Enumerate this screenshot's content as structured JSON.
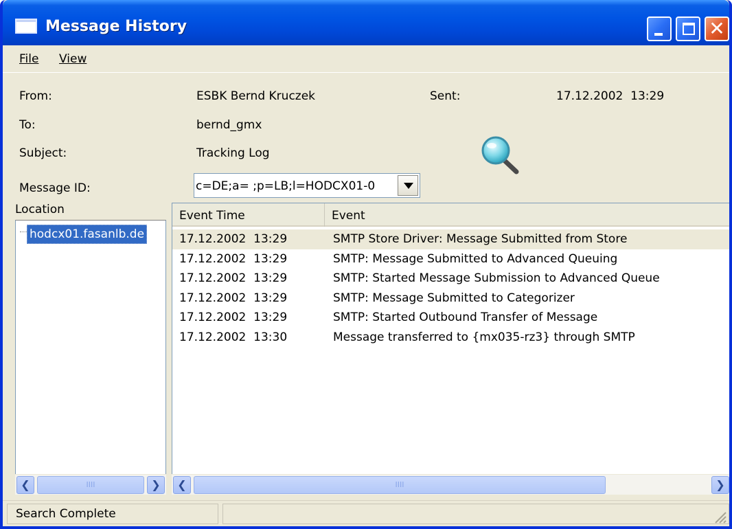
{
  "window": {
    "title": "Message History"
  },
  "menu": {
    "file": "File",
    "view": "View"
  },
  "header": {
    "from_label": "From:",
    "from_value": "ESBK Bernd Kruczek",
    "sent_label": "Sent:",
    "sent_value": "17.12.2002  13:29",
    "to_label": "To:",
    "to_value": "bernd_gmx",
    "subject_label": "Subject:",
    "subject_value": "Tracking Log",
    "msgid_label": "Message ID:",
    "msgid_value": "c=DE;a= ;p=LB;l=HODCX01-0"
  },
  "location": {
    "header": "Location",
    "items": [
      "hodcx01.fasanlb.de"
    ]
  },
  "events": {
    "columns": {
      "time": "Event Time",
      "event": "Event"
    },
    "rows": [
      {
        "time": "17.12.2002  13:29",
        "event": "SMTP Store Driver: Message Submitted from Store"
      },
      {
        "time": "17.12.2002  13:29",
        "event": "SMTP: Message Submitted to Advanced Queuing"
      },
      {
        "time": "17.12.2002  13:29",
        "event": "SMTP: Started Message Submission to Advanced Queue"
      },
      {
        "time": "17.12.2002  13:29",
        "event": "SMTP: Message Submitted to Categorizer"
      },
      {
        "time": "17.12.2002  13:29",
        "event": "SMTP: Started Outbound Transfer of Message"
      },
      {
        "time": "17.12.2002  13:30",
        "event": "Message transferred to {mx035-rz3} through SMTP"
      }
    ]
  },
  "status": {
    "text": "Search Complete"
  },
  "colors": {
    "titlebar": "#0054e3",
    "selection": "#316ac5",
    "window_bg": "#ece9d8"
  }
}
